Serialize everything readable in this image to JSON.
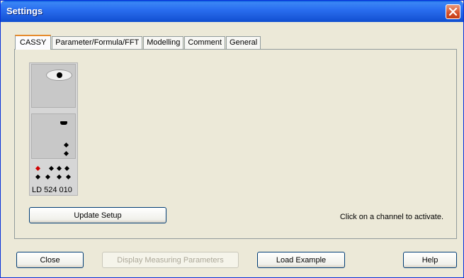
{
  "window": {
    "title": "Settings"
  },
  "tabs": [
    {
      "label": "CASSY",
      "active": true
    },
    {
      "label": "Parameter/Formula/FFT",
      "active": false
    },
    {
      "label": "Modelling",
      "active": false
    },
    {
      "label": "Comment",
      "active": false
    },
    {
      "label": "General",
      "active": false
    }
  ],
  "device": {
    "label": "LD  524 010"
  },
  "panel": {
    "update_button": "Update Setup",
    "hint": "Click on a channel to activate."
  },
  "footer": {
    "close": "Close",
    "display_params": "Display Measuring Parameters",
    "load_example": "Load Example",
    "help": "Help"
  },
  "colors": {
    "titlebar": "#1f5fe0",
    "active_tab_accent": "#e68b2c",
    "indicator_red": "#d00000"
  }
}
